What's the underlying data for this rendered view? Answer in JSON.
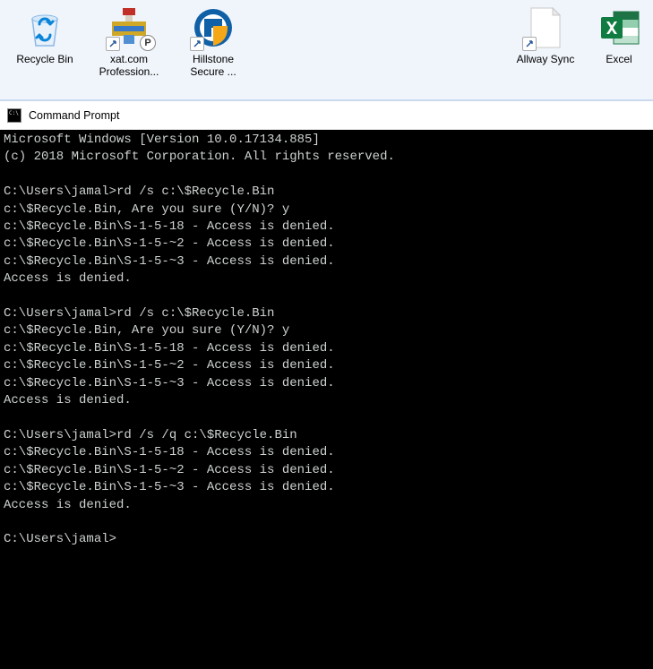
{
  "desktop": {
    "icons": [
      {
        "label": "Recycle Bin",
        "kind": "recycle-bin"
      },
      {
        "label": "xat.com Profession...",
        "kind": "xat"
      },
      {
        "label": "Hillstone Secure ...",
        "kind": "hillstone"
      },
      {
        "label": "Allway Sync",
        "kind": "blank-shortcut"
      },
      {
        "label": "Excel",
        "kind": "excel"
      }
    ]
  },
  "cmd": {
    "title": "Command Prompt",
    "lines": [
      "Microsoft Windows [Version 10.0.17134.885]",
      "(c) 2018 Microsoft Corporation. All rights reserved.",
      "",
      "C:\\Users\\jamal>rd /s c:\\$Recycle.Bin",
      "c:\\$Recycle.Bin, Are you sure (Y/N)? y",
      "c:\\$Recycle.Bin\\S-1-5-18 - Access is denied.",
      "c:\\$Recycle.Bin\\S-1-5-~2 - Access is denied.",
      "c:\\$Recycle.Bin\\S-1-5-~3 - Access is denied.",
      "Access is denied.",
      "",
      "C:\\Users\\jamal>rd /s c:\\$Recycle.Bin",
      "c:\\$Recycle.Bin, Are you sure (Y/N)? y",
      "c:\\$Recycle.Bin\\S-1-5-18 - Access is denied.",
      "c:\\$Recycle.Bin\\S-1-5-~2 - Access is denied.",
      "c:\\$Recycle.Bin\\S-1-5-~3 - Access is denied.",
      "Access is denied.",
      "",
      "C:\\Users\\jamal>rd /s /q c:\\$Recycle.Bin",
      "c:\\$Recycle.Bin\\S-1-5-18 - Access is denied.",
      "c:\\$Recycle.Bin\\S-1-5-~2 - Access is denied.",
      "c:\\$Recycle.Bin\\S-1-5-~3 - Access is denied.",
      "Access is denied.",
      "",
      "C:\\Users\\jamal>"
    ]
  }
}
